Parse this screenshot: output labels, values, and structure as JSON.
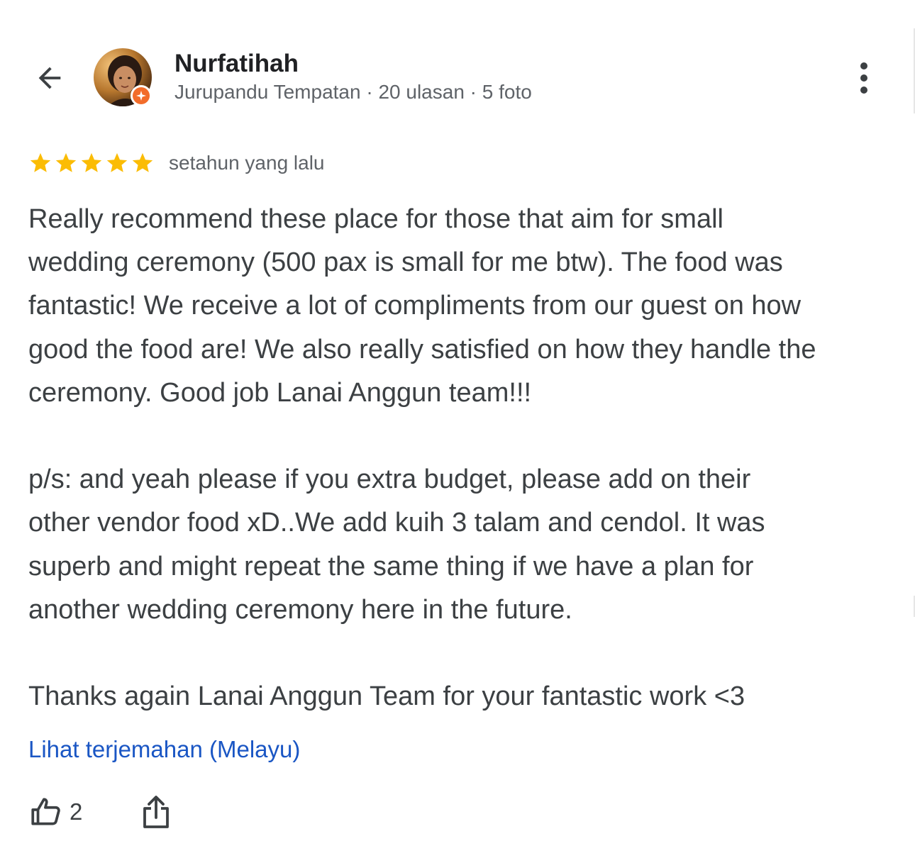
{
  "header": {
    "user_name": "Nurfatihah",
    "user_meta": "Jurupandu Tempatan · 20 ulasan · 5 foto",
    "back_icon": "arrow-left-icon",
    "more_icon": "more-vertical-icon",
    "badge_icon": "local-guide-badge-icon",
    "badge_color": "#f26c2a"
  },
  "review": {
    "rating": 5,
    "max_rating": 5,
    "star_color": "#fbbc04",
    "time_ago": "setahun yang lalu",
    "text": "Really recommend these place for those that aim for small\nwedding ceremony (500 pax is small for me btw). The food was\nfantastic! We receive a lot of compliments from our guest on how\ngood the food are! We also really satisfied on how they handle the\nceremony. Good job Lanai Anggun team!!!\n\np/s: and yeah please if you extra budget, please add on their\nother vendor food xD..We add kuih 3 talam and cendol. It was\nsuperb and might repeat the same thing if we have a plan for\nanother wedding ceremony here in the future.\n\nThanks again Lanai Anggun Team for your fantastic work <3",
    "translate_link": "Lihat terjemahan (Melayu)",
    "link_color": "#1a56c4"
  },
  "actions": {
    "like_count": "2",
    "like_icon": "thumbs-up-icon",
    "share_icon": "share-icon"
  }
}
